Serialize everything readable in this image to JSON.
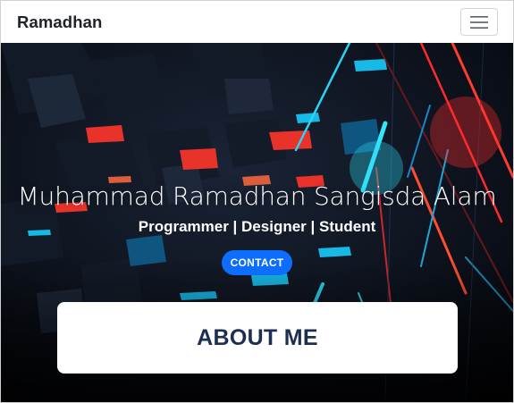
{
  "navbar": {
    "brand": "Ramadhan",
    "toggler_icon": "hamburger-icon"
  },
  "hero": {
    "name": "Muhammad Ramadhan Sangisda Alam",
    "subtitle": "Programmer | Designer | Student",
    "contact_label": "CONTACT"
  },
  "about": {
    "title": "ABOUT ME"
  },
  "colors": {
    "primary_button": "#0d6efd",
    "about_title": "#1c2f50",
    "hero_bg": "#05070d",
    "accent_red": "#ff3b2f",
    "accent_cyan": "#29d5f5"
  }
}
